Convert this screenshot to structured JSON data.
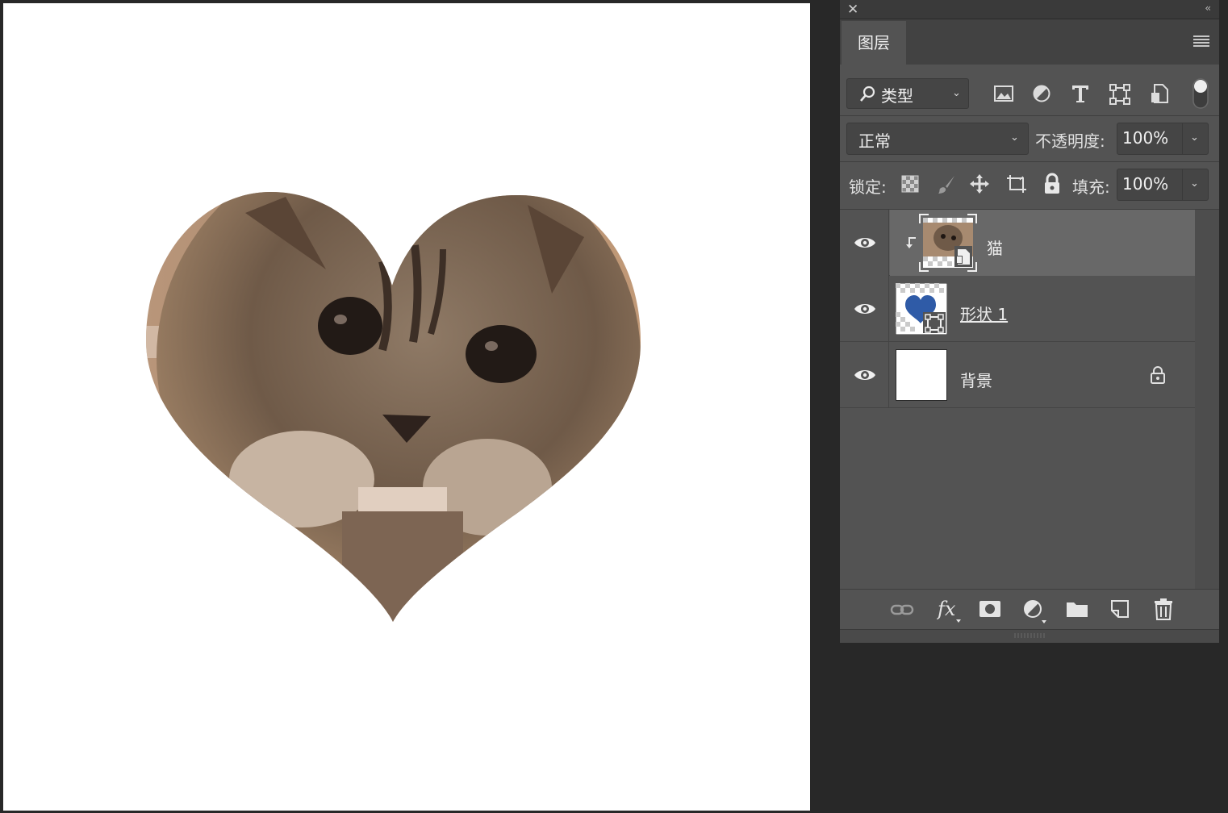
{
  "panel": {
    "tab_label": "图层",
    "filter": {
      "label": "类型"
    },
    "blend": {
      "mode": "正常",
      "opacity_label": "不透明度:",
      "opacity_value": "100%"
    },
    "lock": {
      "label": "锁定:",
      "fill_label": "填充:",
      "fill_value": "100%"
    }
  },
  "layers": [
    {
      "name": "猫",
      "visible": true,
      "kind": "smart-object",
      "clipped": true,
      "selected": true
    },
    {
      "name": "形状 1",
      "visible": true,
      "kind": "shape",
      "clipped": false,
      "selected": false
    },
    {
      "name": "背景",
      "visible": true,
      "kind": "background",
      "locked": true,
      "selected": false
    }
  ],
  "colors": {
    "panel_bg": "#535353",
    "selected_row": "#686868",
    "shape_fill": "#2f5ba7",
    "canvas": "#ffffff"
  }
}
